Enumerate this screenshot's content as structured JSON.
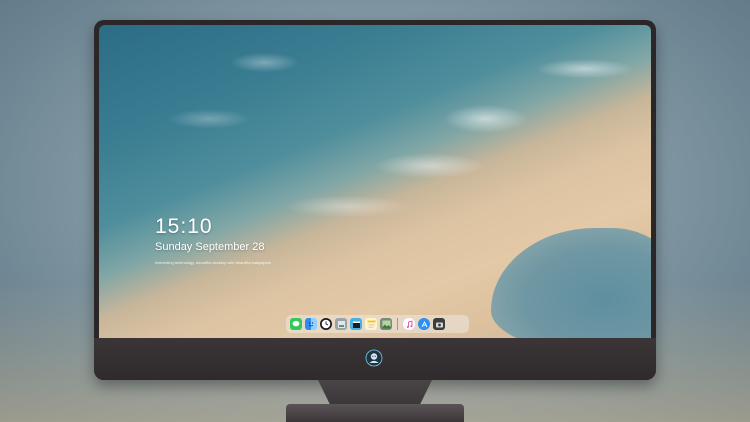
{
  "lockscreen": {
    "time": "15:10",
    "date": "Sunday September 28",
    "caption": "Interesting technology, beautiful desktop with beautiful wallpapers"
  },
  "dock": {
    "apps": [
      {
        "name": "messages-icon",
        "color": "#34c759",
        "glyph": "💬"
      },
      {
        "name": "finder-icon",
        "color": "#2f8cf0",
        "glyph": "☺"
      },
      {
        "name": "clock-icon",
        "color": "#f2f2f2",
        "glyph": "◷"
      },
      {
        "name": "preview-icon",
        "color": "#9aa3a8",
        "glyph": "▦"
      },
      {
        "name": "clapper-icon",
        "color": "#4ab0e0",
        "glyph": "▶"
      },
      {
        "name": "notes-icon",
        "color": "#f4d24a",
        "glyph": "≡"
      },
      {
        "name": "photos-icon",
        "color": "#6bb36b",
        "glyph": "▣"
      },
      {
        "name": "itunes-icon",
        "color": "#e14fa8",
        "glyph": "♫"
      },
      {
        "name": "app-store-icon",
        "color": "#2c8ff5",
        "glyph": "A"
      },
      {
        "name": "camera-icon",
        "color": "#4a4a4a",
        "glyph": "◉"
      }
    ]
  },
  "colors": {
    "bezel": "#2b2628",
    "chin": "#3b3537"
  }
}
